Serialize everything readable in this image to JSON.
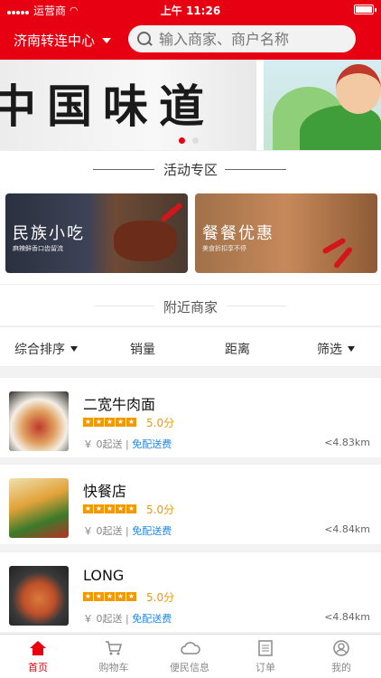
{
  "status": {
    "carrier": "运营商",
    "time": "上午 11:26"
  },
  "header": {
    "city": "济南转连中心",
    "search_placeholder": "输入商家、商户名称"
  },
  "banner": {
    "calligraphy": "中国味道"
  },
  "activity": {
    "title": "活动专区",
    "cards": [
      {
        "title": "民族小吃",
        "subtitle": "麻辣鲜香口齿留流"
      },
      {
        "title": "餐餐优惠",
        "subtitle": "美食折扣享不停"
      }
    ]
  },
  "nearby": {
    "title": "附近商家"
  },
  "filters": {
    "sort": "综合排序",
    "sales": "销量",
    "distance": "距离",
    "filter": "筛选"
  },
  "shops": [
    {
      "name": "二宽牛肉面",
      "rating": "5.0分",
      "min_order": "￥ 0起送",
      "delivery": "免配送费",
      "distance": "<4.83km"
    },
    {
      "name": "快餐店",
      "rating": "5.0分",
      "min_order": "￥ 0起送",
      "delivery": "免配送费",
      "distance": "<4.84km"
    },
    {
      "name": "LONG",
      "rating": "5.0分",
      "min_order": "￥ 0起送",
      "delivery": "免配送费",
      "distance": "<4.84km"
    }
  ],
  "tabbar": {
    "home": "首页",
    "cart": "购物车",
    "info": "便民信息",
    "orders": "订单",
    "mine": "我的"
  },
  "colors": {
    "brand": "#e60012",
    "rating": "#f39800",
    "link": "#1e88e5"
  }
}
